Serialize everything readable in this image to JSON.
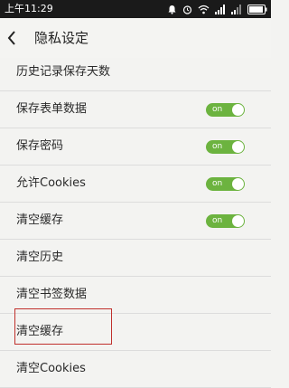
{
  "status_bar": {
    "time": "上午11:29",
    "icons": [
      "notification-bell-icon",
      "alarm-icon",
      "wifi-icon",
      "signal-icon",
      "signal-icon",
      "battery-icon"
    ]
  },
  "header": {
    "title": "隐私设定",
    "back_icon": "chevron-left-icon"
  },
  "settings": [
    {
      "label": "历史记录保存天数"
    },
    {
      "label": "保存表单数据",
      "toggle": "on"
    },
    {
      "label": "保存密码",
      "toggle": "on"
    },
    {
      "label": "允许Cookies",
      "toggle": "on"
    },
    {
      "label": "清空缓存",
      "toggle": "on"
    },
    {
      "label": "清空历史"
    },
    {
      "label": "清空书签数据"
    },
    {
      "label": "清空缓存"
    },
    {
      "label": "清空Cookies"
    }
  ],
  "colors": {
    "toggle_on": "#6cb33f",
    "highlight_border": "#c0302c",
    "status_bar_bg": "#1a1a1a"
  }
}
